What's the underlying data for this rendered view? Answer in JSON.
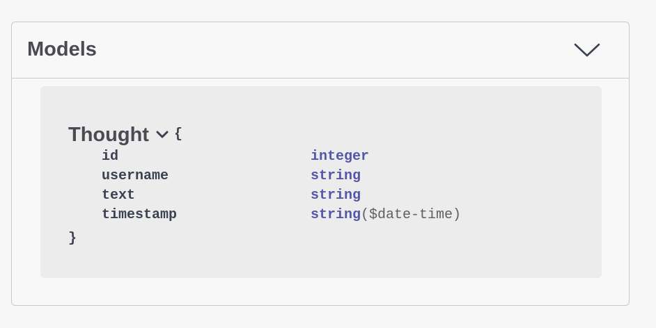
{
  "models": {
    "title": "Models",
    "expanded_icon": "chevron-down-icon",
    "items": [
      {
        "name": "Thought",
        "open_brace": "{",
        "close_brace": "}",
        "toggle_icon": "chevron-down-icon",
        "properties": [
          {
            "name": "id",
            "type": "integer",
            "format": ""
          },
          {
            "name": "username",
            "type": "string",
            "format": ""
          },
          {
            "name": "text",
            "type": "string",
            "format": ""
          },
          {
            "name": "timestamp",
            "type": "string",
            "format": "($date-time)"
          }
        ]
      }
    ]
  },
  "colors": {
    "title_text": "#4a4a52",
    "prop_name": "#3b4151",
    "type_name": "#5555aa",
    "type_format": "#606060",
    "model_box_bg": "#ececec",
    "border": "#c9c9cc"
  }
}
